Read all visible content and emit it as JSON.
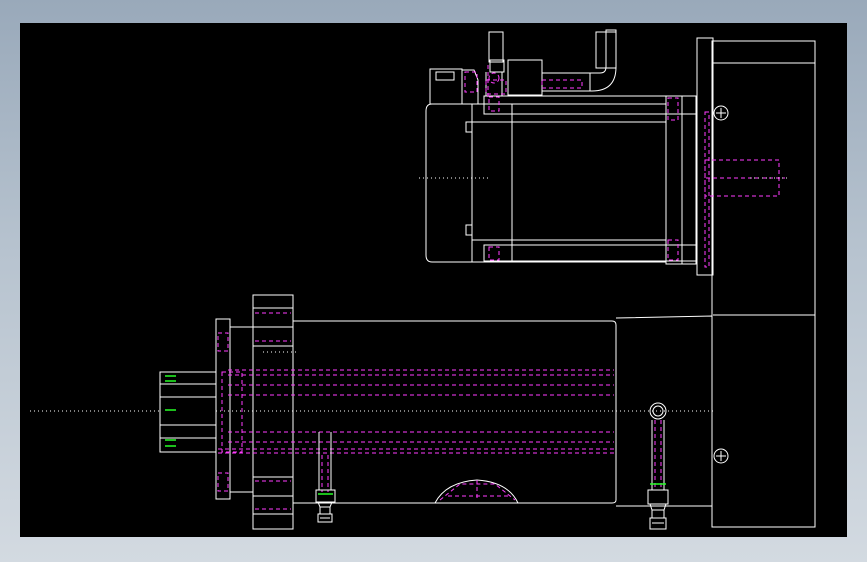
{
  "viewport": {
    "background": "#000000",
    "frame_background": "#b7c3cf"
  },
  "colors": {
    "outline": "#ffffff",
    "hidden": "#ff3cff",
    "center": "#ffffff",
    "accent": "#25ff25"
  },
  "drawing": {
    "views": [
      "upper-motor-assembly",
      "lower-cylinder-assembly",
      "mounting-plate"
    ],
    "line_types": [
      "visible-outline",
      "hidden-dashed",
      "center-dotted"
    ]
  }
}
